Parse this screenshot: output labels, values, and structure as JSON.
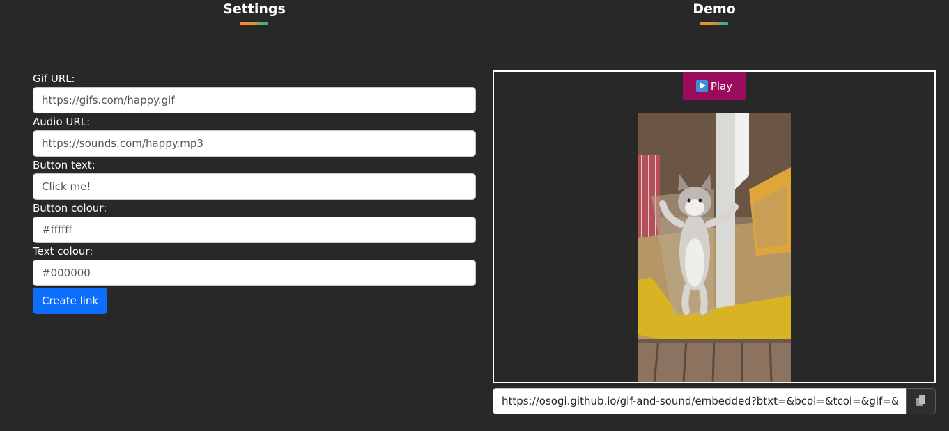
{
  "headings": {
    "settings": "Settings",
    "demo": "Demo"
  },
  "form": {
    "gif_url": {
      "label": "Gif URL:",
      "placeholder": "https://gifs.com/happy.gif"
    },
    "audio_url": {
      "label": "Audio URL:",
      "placeholder": "https://sounds.com/happy.mp3"
    },
    "button_text": {
      "label": "Button text:",
      "placeholder": "Click me!"
    },
    "button_colour": {
      "label": "Button colour:",
      "placeholder": "#ffffff"
    },
    "text_colour": {
      "label": "Text colour:",
      "placeholder": "#000000"
    },
    "create_label": "Create link"
  },
  "demo": {
    "play_label": "Play",
    "play_icon": "play-button-emoji-icon",
    "play_bg": "#9b0b5c",
    "gif_subject": "kitten-standing-in-doorway"
  },
  "share": {
    "link_value": "https://osogi.github.io/gif-and-sound/embedded?btxt=&bcol=&tcol=&gif=&aud",
    "copy_icon": "copy-clipboard-icon"
  },
  "colors": {
    "background": "#282828",
    "primary": "#0d6efd",
    "accent_orange": "#f28c28",
    "accent_teal": "#1bb5a5"
  }
}
